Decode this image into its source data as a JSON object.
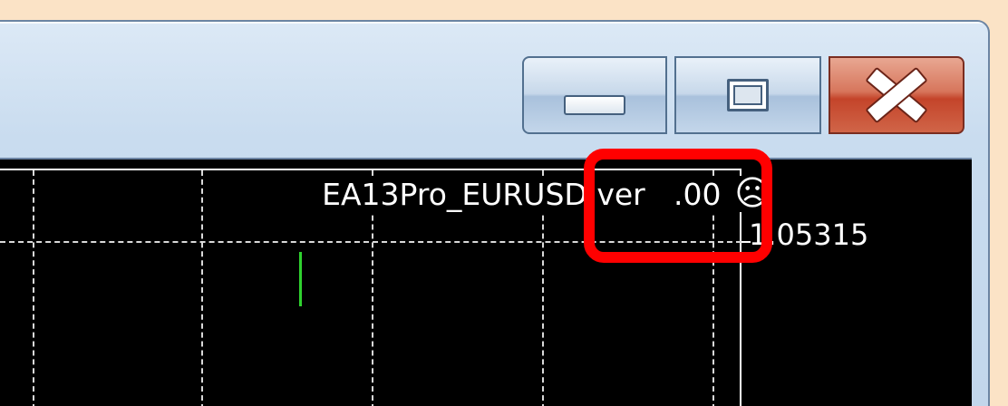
{
  "window": {
    "caption_buttons": [
      {
        "id": "minimize",
        "icon": "minimize-icon"
      },
      {
        "id": "maximize",
        "icon": "maximize-icon"
      },
      {
        "id": "close",
        "icon": "close-icon",
        "color": "#c4442a"
      }
    ]
  },
  "chart": {
    "ea_label": "EA13Pro_EURUSD ver",
    "ea_version_fragment": ".00",
    "status_icon": "sad-face-icon",
    "price_label": "1.05315",
    "candle_color": "#2fd22f"
  },
  "annotation": {
    "highlight_color": "#ff0000"
  }
}
